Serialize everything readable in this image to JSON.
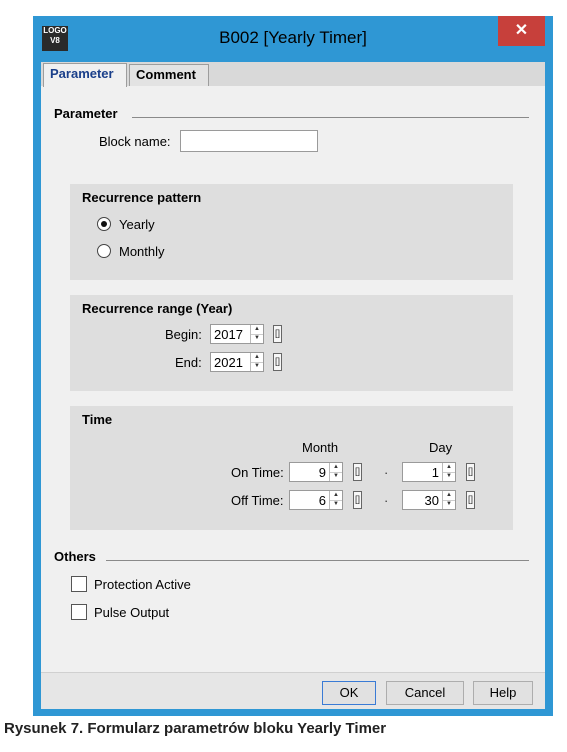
{
  "window": {
    "title": "B002 [Yearly Timer]",
    "app_icon_text": [
      "LOGO",
      "V8"
    ],
    "close_glyph": "✕"
  },
  "tabs": [
    {
      "label": "Parameter",
      "active": true
    },
    {
      "label": "Comment",
      "active": false
    }
  ],
  "parameter": {
    "section_title": "Parameter",
    "block_name_label": "Block name:",
    "block_name_value": ""
  },
  "recurrence_pattern": {
    "title": "Recurrence pattern",
    "options": [
      {
        "label": "Yearly",
        "selected": true
      },
      {
        "label": "Monthly",
        "selected": false
      }
    ]
  },
  "recurrence_range": {
    "title": "Recurrence range (Year)",
    "begin_label": "Begin:",
    "begin_value": "2017",
    "end_label": "End:",
    "end_value": "2021"
  },
  "time": {
    "title": "Time",
    "month_header": "Month",
    "day_header": "Day",
    "on_label": "On Time:",
    "on_month": "9",
    "on_day": "1",
    "off_label": "Off Time:",
    "off_month": "6",
    "off_day": "30",
    "separator": "·",
    "bracket_glyph": "[]"
  },
  "others": {
    "section_title": "Others",
    "protection_label": "Protection Active",
    "protection_checked": false,
    "pulse_label": "Pulse Output",
    "pulse_checked": false
  },
  "buttons": {
    "ok": "OK",
    "cancel": "Cancel",
    "help": "Help"
  },
  "caption": "Rysunek 7. Formularz parametrów bloku Yearly Timer",
  "colors": {
    "title_bar": "#2f97d4",
    "close_button": "#c7403b",
    "dialog_bg": "#f0f0f0",
    "group_bg": "#dedede",
    "active_tab_text": "#1a3f8a"
  }
}
